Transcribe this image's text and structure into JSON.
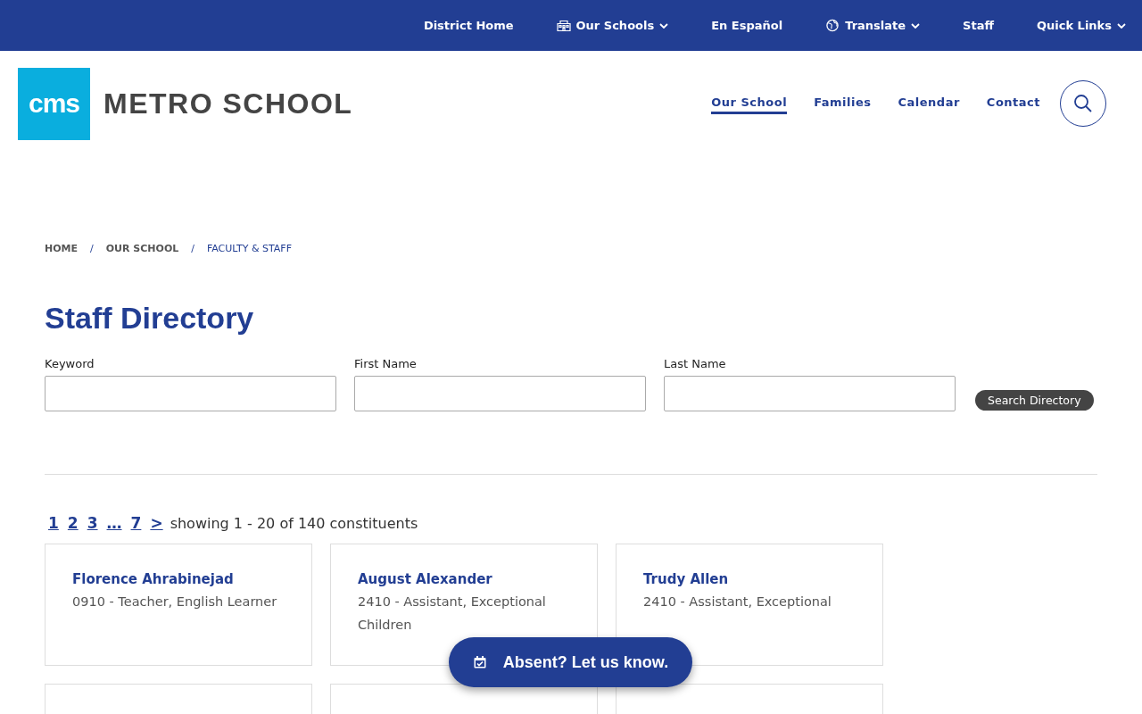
{
  "top_bar": {
    "links": [
      {
        "label": "District Home",
        "kind": "plain",
        "dropdown": false
      },
      {
        "label": "Our Schools",
        "kind": "schools",
        "dropdown": true
      },
      {
        "label": "En Español",
        "kind": "plain",
        "dropdown": false
      },
      {
        "label": "Translate",
        "kind": "language",
        "dropdown": true
      },
      {
        "label": "Staff",
        "kind": "plain",
        "dropdown": false
      },
      {
        "label": "Quick Links",
        "kind": "plain",
        "dropdown": true
      }
    ]
  },
  "header": {
    "logo_text": "cms",
    "school_name": "METRO SCHOOL",
    "nav": [
      {
        "label": "Our School",
        "selected": true
      },
      {
        "label": "Families",
        "selected": false
      },
      {
        "label": "Calendar",
        "selected": false
      },
      {
        "label": "Contact",
        "selected": false
      }
    ]
  },
  "breadcrumb": [
    "HOME",
    "OUR SCHOOL",
    "FACULTY & STAFF"
  ],
  "breadcrumb_separator": "/",
  "title": "Staff Directory",
  "search": {
    "fields": [
      {
        "label": "Keyword"
      },
      {
        "label": "First Name"
      },
      {
        "label": "Last Name"
      }
    ],
    "button": "Search Directory"
  },
  "pagination": {
    "pages": [
      "1",
      "2",
      "3",
      "…",
      "7",
      ">"
    ],
    "summary": "showing 1 - 20 of 140 constituents"
  },
  "cards": [
    {
      "name": "Florence Ahrabinejad",
      "role": "0910 - Teacher, English Learner"
    },
    {
      "name": "August Alexander",
      "role": "2410 - Assistant, Exceptional Children"
    },
    {
      "name": "Trudy Allen",
      "role": "2410 - Assistant, Exceptional"
    }
  ],
  "absent_button": "Absent? Let us know."
}
